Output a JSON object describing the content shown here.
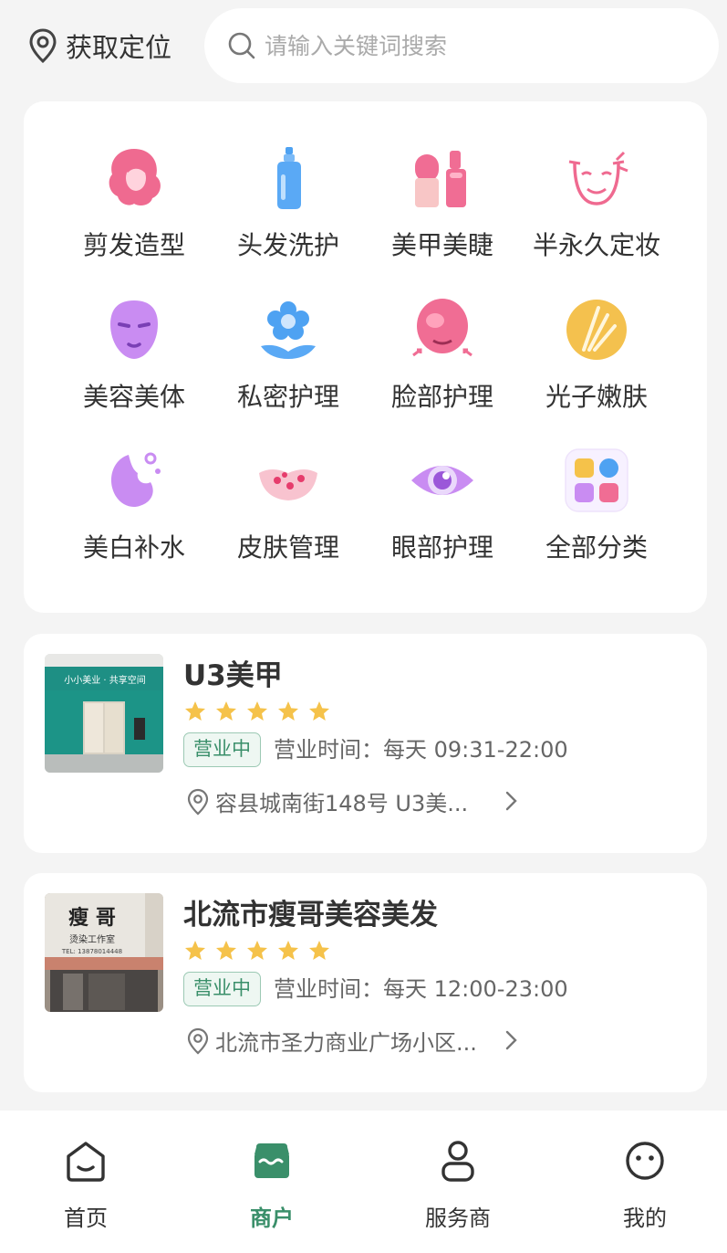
{
  "header": {
    "location_label": "获取定位",
    "search_placeholder": "请输入关键词搜索"
  },
  "categories": [
    {
      "label": "剪发造型",
      "icon": "hair-styling-icon"
    },
    {
      "label": "头发洗护",
      "icon": "shampoo-bottle-icon"
    },
    {
      "label": "美甲美睫",
      "icon": "nail-polish-icon"
    },
    {
      "label": "半永久定妆",
      "icon": "face-makeup-icon"
    },
    {
      "label": "美容美体",
      "icon": "face-mask-icon"
    },
    {
      "label": "私密护理",
      "icon": "flower-icon"
    },
    {
      "label": "脸部护理",
      "icon": "face-care-icon"
    },
    {
      "label": "光子嫩肤",
      "icon": "light-rejuvenation-icon"
    },
    {
      "label": "美白补水",
      "icon": "whitening-hydration-icon"
    },
    {
      "label": "皮肤管理",
      "icon": "skin-care-icon"
    },
    {
      "label": "眼部护理",
      "icon": "eye-icon"
    },
    {
      "label": "全部分类",
      "icon": "all-categories-icon"
    }
  ],
  "shops": [
    {
      "name": "U3美甲",
      "rating": 5,
      "status": "营业中",
      "hours": "营业时间：每天 09:31-22:00",
      "address": "容县城南街148号 U3美...",
      "thumb_sign": "小小美业 · 共享空间"
    },
    {
      "name": "北流市瘦哥美容美发",
      "rating": 5,
      "status": "营业中",
      "hours": "营业时间：每天 12:00-23:00",
      "address": "北流市圣力商业广场小区...",
      "thumb_sign": "瘦 哥",
      "thumb_sub": "烫染工作室",
      "thumb_tel": "TEL: 13878014448"
    }
  ],
  "tabs": [
    {
      "label": "首页",
      "icon": "home-icon",
      "active": false
    },
    {
      "label": "商户",
      "icon": "store-icon",
      "active": true
    },
    {
      "label": "服务商",
      "icon": "person-icon",
      "active": false
    },
    {
      "label": "我的",
      "icon": "smiley-icon",
      "active": false
    }
  ],
  "colors": {
    "accent": "#3a8f6a",
    "star": "#f5c24a",
    "pink": "#f06d94",
    "background": "#f4f4f4"
  }
}
